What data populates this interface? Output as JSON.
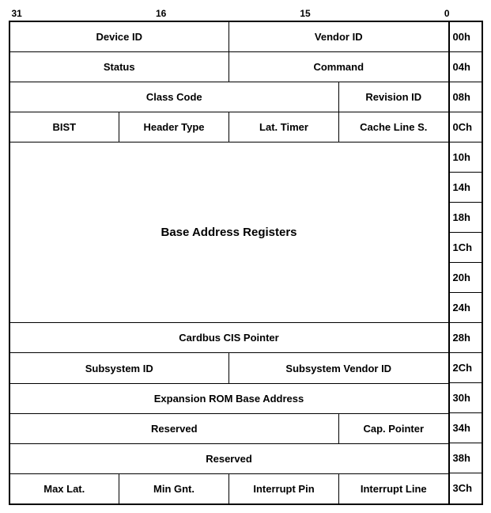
{
  "header": {
    "bit31": "31",
    "bit16": "16",
    "bit15": "15",
    "bit0": "0"
  },
  "rows": [
    {
      "cells": [
        {
          "text": "Device ID",
          "colspan": 1,
          "width": "50%"
        },
        {
          "text": "Vendor ID",
          "colspan": 1,
          "width": "50%"
        }
      ],
      "addr": "00h"
    },
    {
      "cells": [
        {
          "text": "Status",
          "colspan": 1,
          "width": "50%"
        },
        {
          "text": "Command",
          "colspan": 1,
          "width": "50%"
        }
      ],
      "addr": "04h"
    },
    {
      "cells": [
        {
          "text": "Class Code",
          "colspan": 1,
          "width": "70%"
        },
        {
          "text": "Revision ID",
          "colspan": 1,
          "width": "30%"
        }
      ],
      "addr": "08h"
    },
    {
      "cells": [
        {
          "text": "BIST",
          "colspan": 1,
          "width": "25%"
        },
        {
          "text": "Header Type",
          "colspan": 1,
          "width": "25%"
        },
        {
          "text": "Lat. Timer",
          "colspan": 1,
          "width": "25%"
        },
        {
          "text": "Cache Line S.",
          "colspan": 1,
          "width": "25%"
        }
      ],
      "addr": "0Ch"
    }
  ],
  "bar_section": {
    "text": "Base Address Registers",
    "addrs": [
      "10h",
      "14h",
      "18h",
      "1Ch",
      "20h",
      "24h"
    ]
  },
  "lower_rows": [
    {
      "cells": [
        {
          "text": "Cardbus CIS Pointer",
          "colspan": 1,
          "width": "100%"
        }
      ],
      "addr": "28h"
    },
    {
      "cells": [
        {
          "text": "Subsystem ID",
          "colspan": 1,
          "width": "50%"
        },
        {
          "text": "Subsystem Vendor ID",
          "colspan": 1,
          "width": "50%"
        }
      ],
      "addr": "2Ch"
    },
    {
      "cells": [
        {
          "text": "Expansion ROM Base Address",
          "colspan": 1,
          "width": "100%"
        }
      ],
      "addr": "30h"
    },
    {
      "cells": [
        {
          "text": "Reserved",
          "colspan": 1,
          "width": "70%"
        },
        {
          "text": "Cap. Pointer",
          "colspan": 1,
          "width": "30%"
        }
      ],
      "addr": "34h"
    },
    {
      "cells": [
        {
          "text": "Reserved",
          "colspan": 1,
          "width": "100%"
        }
      ],
      "addr": "38h"
    },
    {
      "cells": [
        {
          "text": "Max Lat.",
          "colspan": 1,
          "width": "25%"
        },
        {
          "text": "Min Gnt.",
          "colspan": 1,
          "width": "25%"
        },
        {
          "text": "Interrupt Pin",
          "colspan": 1,
          "width": "25%"
        },
        {
          "text": "Interrupt Line",
          "colspan": 1,
          "width": "25%"
        }
      ],
      "addr": "3Ch"
    }
  ]
}
